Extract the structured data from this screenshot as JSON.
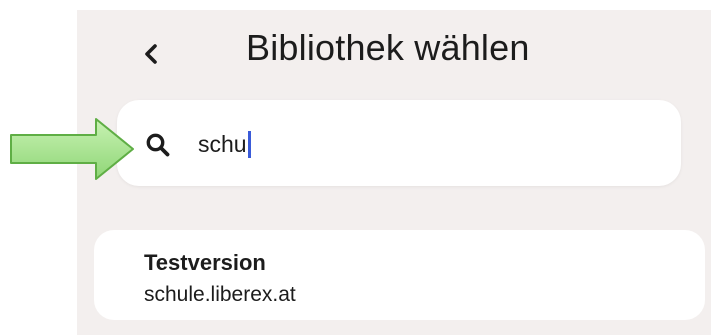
{
  "header": {
    "title": "Bibliothek wählen",
    "back_icon": "chevron-left-icon"
  },
  "search": {
    "value": "schu",
    "icon": "search-icon",
    "caret_color": "#3a5bd9"
  },
  "results": [
    {
      "name": "Testversion",
      "url": "schule.liberex.at"
    }
  ],
  "annotation": {
    "icon": "arrow-right-icon",
    "fill": "#a6e58a",
    "stroke": "#5fae45"
  },
  "colors": {
    "background": "#f3efee",
    "card": "#ffffff",
    "text": "#1c1c1c"
  }
}
